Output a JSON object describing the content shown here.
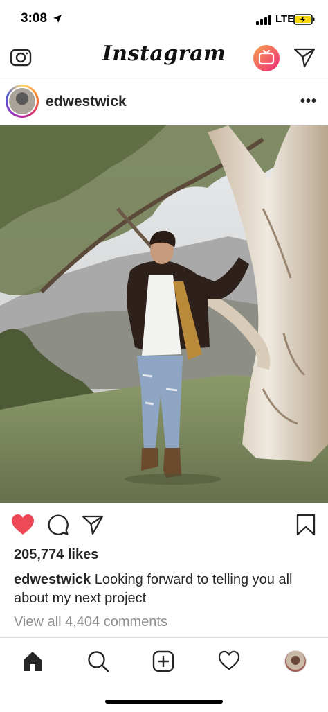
{
  "status_bar": {
    "time": "3:08",
    "network": "LTE"
  },
  "header": {
    "logo_text": "Instagram"
  },
  "post": {
    "username": "edwestwick",
    "likes": "205,774 likes",
    "caption_user": "edwestwick",
    "caption_text": "Looking forward to telling you all about my next project",
    "view_comments": "View all 4,404 comments"
  },
  "icons": {
    "camera": "camera-icon",
    "igtv": "igtv-icon",
    "direct": "direct-message-icon",
    "more": "more-options-icon",
    "like": "heart-filled-icon",
    "comment": "comment-icon",
    "share": "share-icon",
    "save": "bookmark-icon",
    "home": "home-icon",
    "search": "search-icon",
    "add": "add-post-icon",
    "activity": "heart-outline-icon"
  },
  "colors": {
    "like_red": "#ed4956",
    "text": "#262626",
    "secondary_text": "#8e8e8e",
    "divider": "#dbdbdb",
    "battery_charging": "#ffd60a"
  }
}
